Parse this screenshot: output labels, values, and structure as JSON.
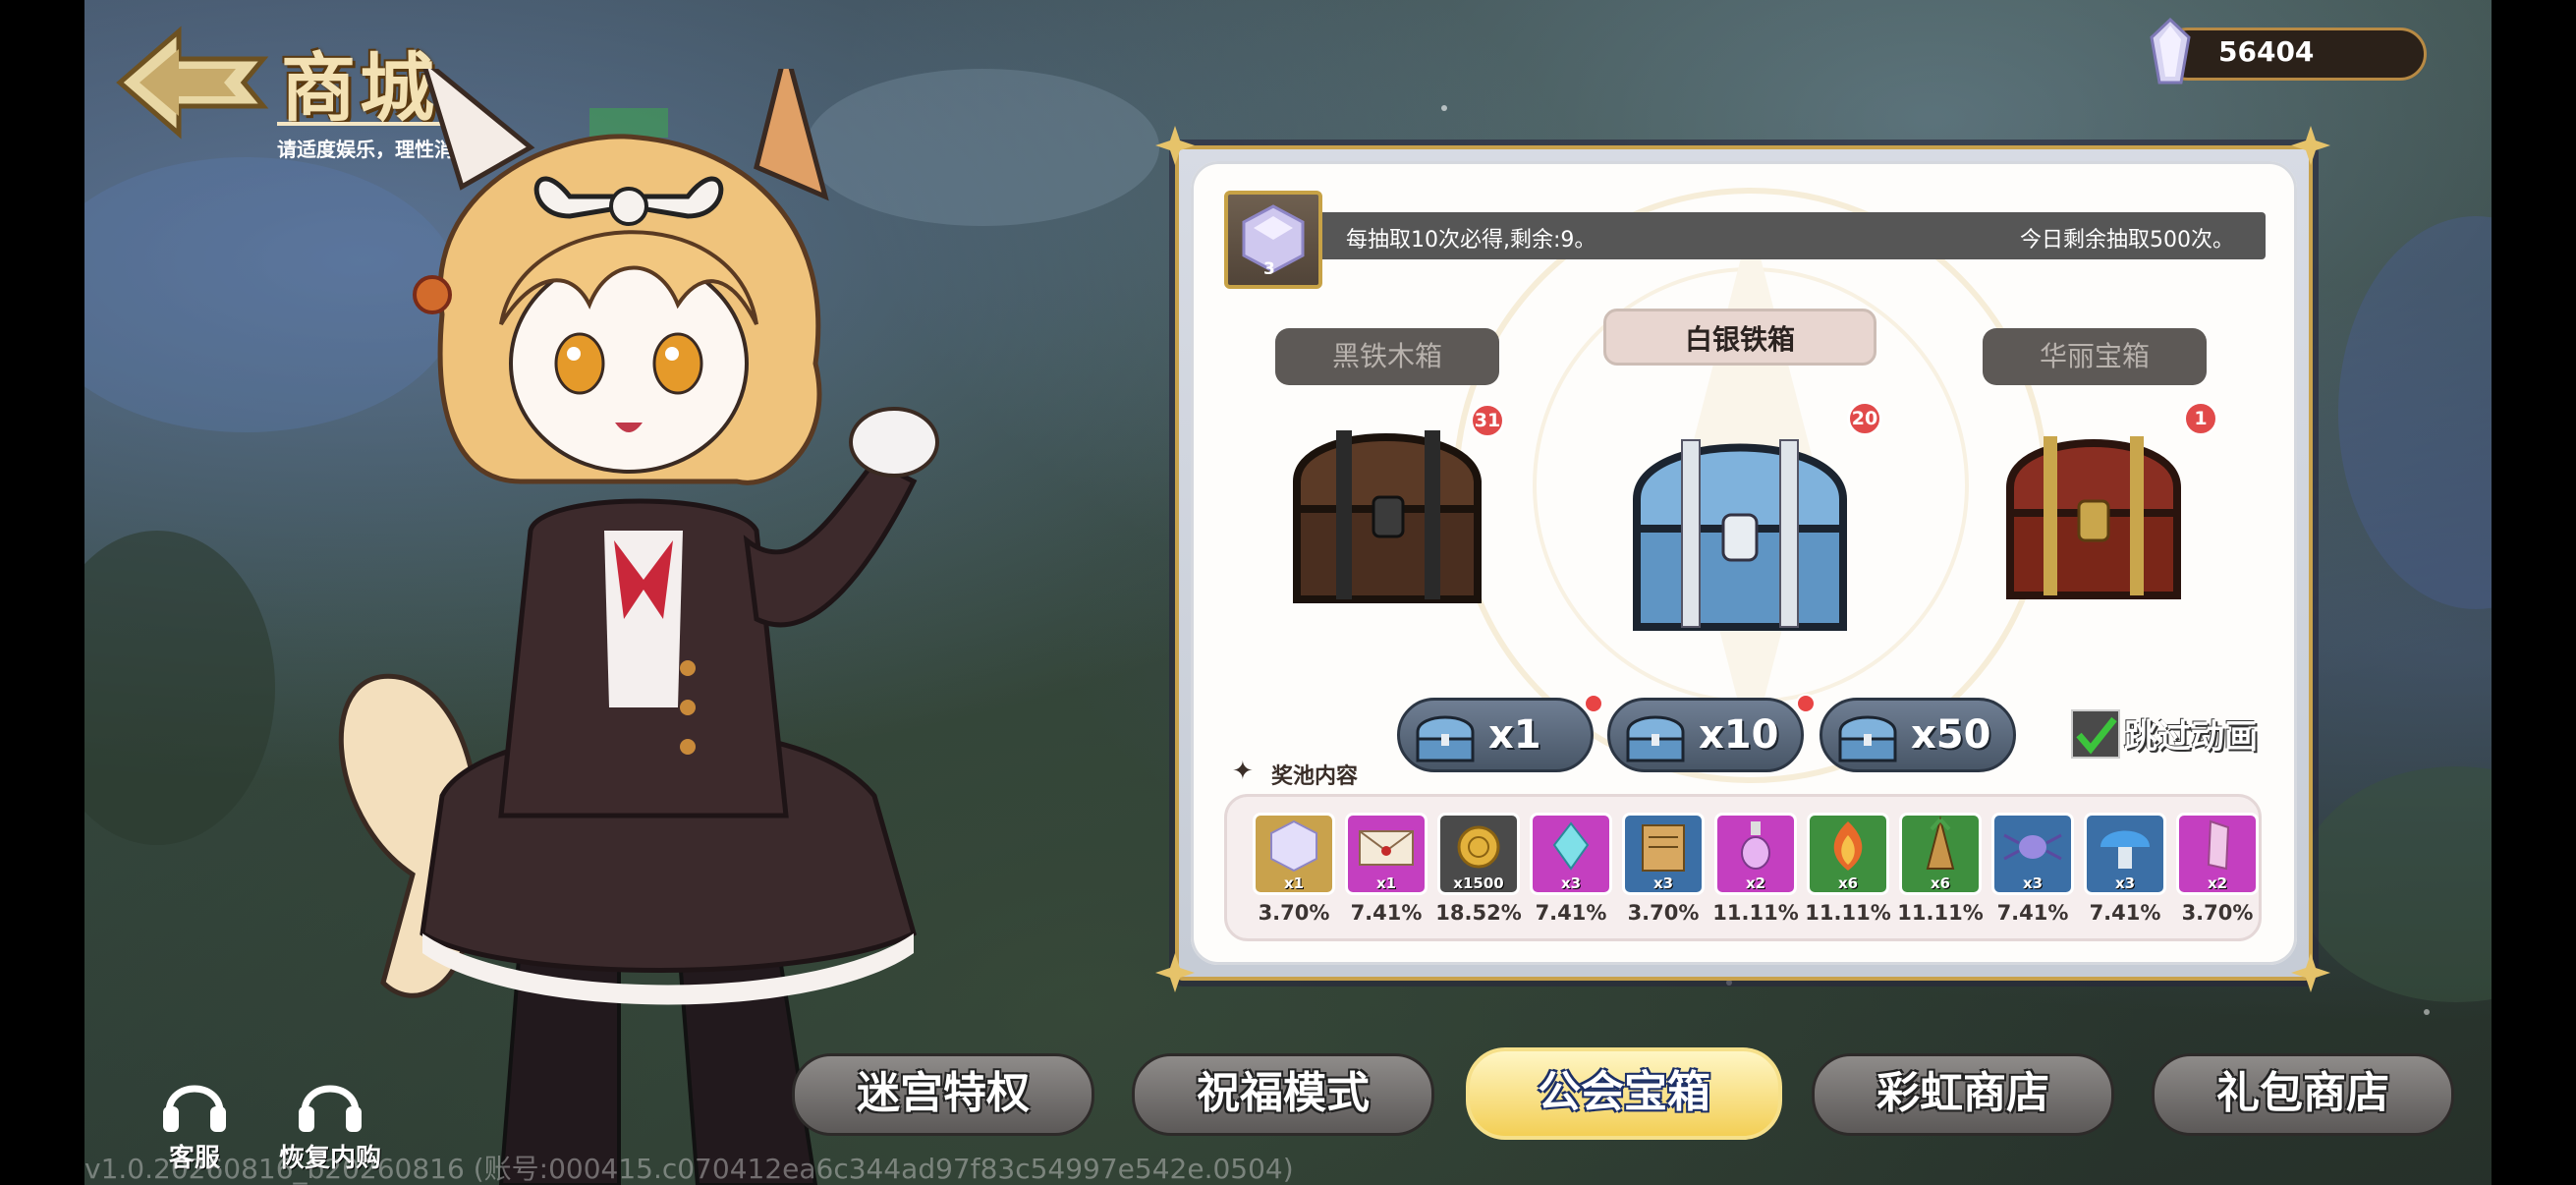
{
  "header": {
    "title": "商城",
    "subtitle": "请适度娱乐，理性消费。"
  },
  "currency": {
    "value": "56404",
    "icon": "crystal-gem-icon"
  },
  "panel": {
    "key_item_qty": "3",
    "info_left": "每抽取10次必得,剩余:9。",
    "info_right": "今日剩余抽取500次。",
    "chests": [
      {
        "label": "黑铁木箱",
        "badge": "31",
        "active": false
      },
      {
        "label": "白银铁箱",
        "badge": "20",
        "active": true
      },
      {
        "label": "华丽宝箱",
        "badge": "1",
        "active": false
      }
    ],
    "draw_buttons": [
      {
        "label": "x1",
        "has_dot": true
      },
      {
        "label": "x10",
        "has_dot": true
      },
      {
        "label": "x50",
        "has_dot": false
      }
    ],
    "skip_label": "跳过动画",
    "skip_checked": true,
    "pool_title": "奖池内容",
    "rewards": [
      {
        "qty": "x1",
        "pct": "3.70%",
        "color": "#c9a24c",
        "icon": "crystal-icon"
      },
      {
        "qty": "x1",
        "pct": "7.41%",
        "color": "#c43fc0",
        "icon": "letter-icon"
      },
      {
        "qty": "x1500",
        "pct": "18.52%",
        "color": "#4a4a4a",
        "icon": "gold-coin-icon"
      },
      {
        "qty": "x3",
        "pct": "7.41%",
        "color": "#c43fc0",
        "icon": "gem-icon"
      },
      {
        "qty": "x3",
        "pct": "3.70%",
        "color": "#3b6fa6",
        "icon": "scroll-icon"
      },
      {
        "qty": "x2",
        "pct": "11.11%",
        "color": "#c43fc0",
        "icon": "potion-icon"
      },
      {
        "qty": "x6",
        "pct": "11.11%",
        "color": "#3e8f3e",
        "icon": "flame-plant-icon"
      },
      {
        "qty": "x6",
        "pct": "11.11%",
        "color": "#3e8f3e",
        "icon": "root-icon"
      },
      {
        "qty": "x3",
        "pct": "7.41%",
        "color": "#3b6fa6",
        "icon": "spider-icon"
      },
      {
        "qty": "x3",
        "pct": "7.41%",
        "color": "#3b6fa6",
        "icon": "mushroom-icon"
      },
      {
        "qty": "x2",
        "pct": "3.70%",
        "color": "#c43fc0",
        "icon": "crystal-shard-icon"
      }
    ]
  },
  "bottom_tabs": [
    {
      "label": "迷宫特权",
      "active": false
    },
    {
      "label": "祝福模式",
      "active": false
    },
    {
      "label": "公会宝箱",
      "active": true
    },
    {
      "label": "彩虹商店",
      "active": false
    },
    {
      "label": "礼包商店",
      "active": false
    }
  ],
  "utilities": [
    {
      "label": "客服",
      "icon": "headset-icon"
    },
    {
      "label": "恢复内购",
      "icon": "headset-icon"
    }
  ],
  "version": "v1.0.20260816_b20260816 (账号:000415.c070412ea6c344ad97f83c54997e542e.0504)",
  "colors": {
    "accent_gold": "#c9a24c",
    "active_tab": "#f3cf56"
  }
}
